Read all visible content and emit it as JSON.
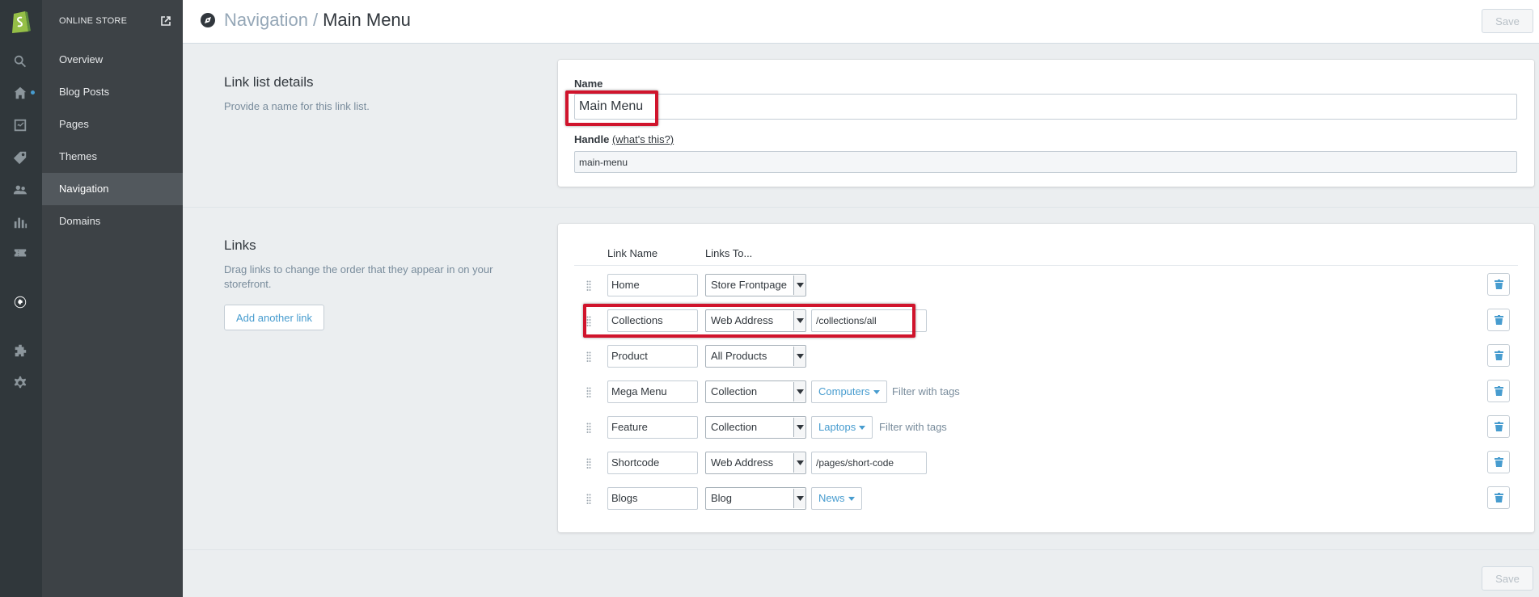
{
  "sidebar": {
    "store_label": "ONLINE STORE",
    "items": [
      {
        "label": "Overview"
      },
      {
        "label": "Blog Posts"
      },
      {
        "label": "Pages"
      },
      {
        "label": "Themes"
      },
      {
        "label": "Navigation"
      },
      {
        "label": "Domains"
      }
    ],
    "active": "Navigation"
  },
  "header": {
    "parent": "Navigation",
    "separator": "/",
    "current": "Main Menu",
    "save_label": "Save"
  },
  "details": {
    "title": "Link list details",
    "description": "Provide a name for this link list.",
    "name_label": "Name",
    "name_value": "Main Menu",
    "handle_label": "Handle",
    "handle_help": "(what's this?)",
    "handle_value": "main-menu"
  },
  "links": {
    "title": "Links",
    "description_line1": "Drag links to change the order that they appear in on your",
    "description_line2": "storefront.",
    "add_button": "Add another link",
    "col_name": "Link Name",
    "col_to": "Links To...",
    "rows": [
      {
        "name": "Home",
        "type": "Store Frontpage"
      },
      {
        "name": "Collections",
        "type": "Web Address",
        "url": "/collections/all"
      },
      {
        "name": "Product",
        "type": "All Products"
      },
      {
        "name": "Mega Menu",
        "type": "Collection",
        "target": "Computers",
        "filter": "Filter with tags"
      },
      {
        "name": "Feature",
        "type": "Collection",
        "target": "Laptops",
        "filter": "Filter with tags"
      },
      {
        "name": "Shortcode",
        "type": "Web Address",
        "url": "/pages/short-code"
      },
      {
        "name": "Blogs",
        "type": "Blog",
        "target": "News"
      }
    ]
  },
  "footer": {
    "save_label": "Save"
  },
  "colors": {
    "accent": "#479ccf",
    "highlight": "#d0142c",
    "sidebar": "#3d4246",
    "rail": "#30373b"
  },
  "icons": [
    "shopify-logo-icon",
    "search-icon",
    "home-icon",
    "orders-icon",
    "products-icon",
    "customers-icon",
    "reports-icon",
    "discounts-icon",
    "online-store-icon",
    "apps-icon",
    "settings-icon",
    "external-link-icon",
    "compass-icon",
    "drag-handle-icon",
    "trash-icon",
    "caret-down-icon"
  ]
}
